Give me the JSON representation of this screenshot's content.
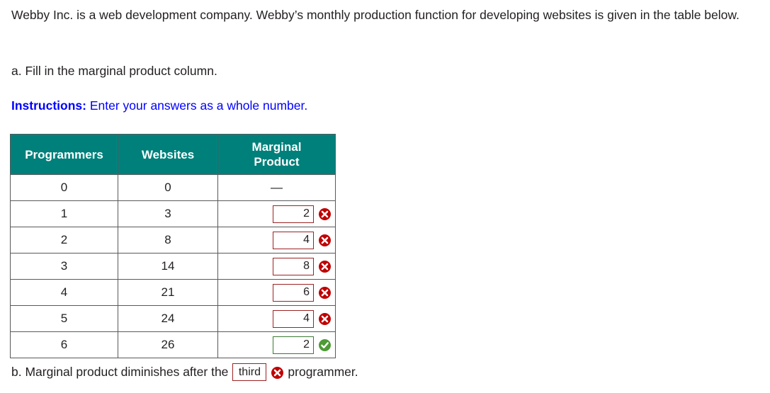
{
  "problem": {
    "intro": "Webby Inc. is a web development company. Webby’s monthly production function for developing websites is given in the table below.",
    "part_a": "a. Fill in the marginal product column.",
    "instructions_lead": "Instructions:",
    "instructions_text": " Enter your answers as a whole number."
  },
  "table": {
    "headers": {
      "programmers": "Programmers",
      "websites": "Websites",
      "marginal_product_line1": "Marginal",
      "marginal_product_line2": "Product"
    },
    "rows": [
      {
        "programmers": "0",
        "websites": "0",
        "marginal_product": "—",
        "has_input": false,
        "status": "none"
      },
      {
        "programmers": "1",
        "websites": "3",
        "marginal_product": "2",
        "has_input": true,
        "status": "incorrect"
      },
      {
        "programmers": "2",
        "websites": "8",
        "marginal_product": "4",
        "has_input": true,
        "status": "incorrect"
      },
      {
        "programmers": "3",
        "websites": "14",
        "marginal_product": "8",
        "has_input": true,
        "status": "incorrect"
      },
      {
        "programmers": "4",
        "websites": "21",
        "marginal_product": "6",
        "has_input": true,
        "status": "incorrect"
      },
      {
        "programmers": "5",
        "websites": "24",
        "marginal_product": "4",
        "has_input": true,
        "status": "incorrect"
      },
      {
        "programmers": "6",
        "websites": "26",
        "marginal_product": "2",
        "has_input": true,
        "status": "correct"
      }
    ]
  },
  "part_b": {
    "text_before": "b. Marginal product diminishes after the",
    "answer_value": "third",
    "text_after": "programmer.",
    "status": "incorrect"
  },
  "icons": {
    "incorrect": "error-x-icon",
    "correct": "success-check-icon"
  },
  "colors": {
    "header_teal": "#00807b",
    "instructions_blue": "#0000ff",
    "incorrect_red": "#9c2222",
    "correct_green": "#3b7a33",
    "text_dark": "#231f20",
    "border_gray": "#58595b"
  }
}
